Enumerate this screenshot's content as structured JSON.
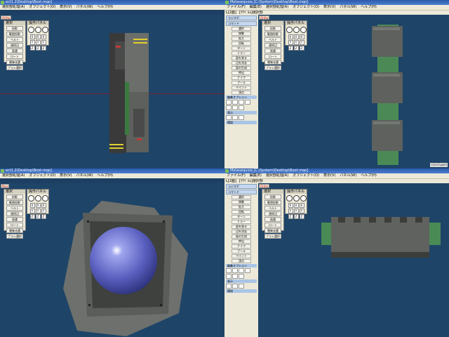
{
  "windows": [
    {
      "title": "ect1.2\\Desktop\\Boot.mqo]",
      "menu": [
        "選択部処理(A)",
        "オブジェクト(O)",
        "表示(V)",
        "パネル(W)",
        "ヘルプ(H)"
      ]
    },
    {
      "title": "Metasequoia [C:\\System\\Desktop\\Boot.mqo]",
      "menu": [
        "ファイル(F)",
        "編集(E)",
        "選択部処理(A)",
        "オブジェクト(O)",
        "表示(V)",
        "パネル(W)",
        "ヘルプ(H)"
      ]
    },
    {
      "title": "ect1.2\\Desktop\\Boot.mqo]",
      "menu": [
        "選択部処理(A)",
        "オブジェクト(O)",
        "表示(V)",
        "パネル(W)",
        "ヘルプ(H)"
      ]
    },
    {
      "title": "Metasequoia [C:\\System\\Desktop\\Boot.mqo]",
      "menu": [
        "ファイル(F)",
        "編集(E)",
        "選択部処理(A)",
        "オブジェクト(O)",
        "表示(V)",
        "パネル(W)",
        "ヘルプ(H)"
      ]
    }
  ],
  "subbar": [
    "L[2面]",
    "[ﾜﾁﾍﾞﾙﾑ]選択部"
  ],
  "viewport_buttons": {
    "ortho": "Ortho",
    "persp": "Pers",
    "b1": "前",
    "b2": "前",
    "b3": "T面"
  },
  "tool_panel": {
    "title": "選択",
    "buttons": [
      "投影",
      "範囲投影",
      "ベルト",
      "連続辺",
      "面選",
      "ロート",
      "曖昧化選",
      "ブラシ選択"
    ]
  },
  "op_panel": {
    "title": "操作パネル",
    "axes": [
      "X",
      "X",
      "X",
      "Y",
      "Y",
      "Y",
      "Z",
      "Z",
      "Z"
    ]
  },
  "command_panel": {
    "tabs": [
      "ラジオボ",
      "コマンド"
    ],
    "commands": [
      "選択",
      "移動",
      "拡大",
      "回転",
      "ターン",
      "ミラー",
      "面を張る",
      "辺を消去",
      "面の生成",
      "押出",
      "ナイフ",
      "ブール",
      "ペイント",
      "頂点"
    ],
    "section1": "編集オプション",
    "section2": "表示",
    "section3": "環境"
  },
  "corner_label": "ﾃｸｽﾁｬ2.ppm"
}
